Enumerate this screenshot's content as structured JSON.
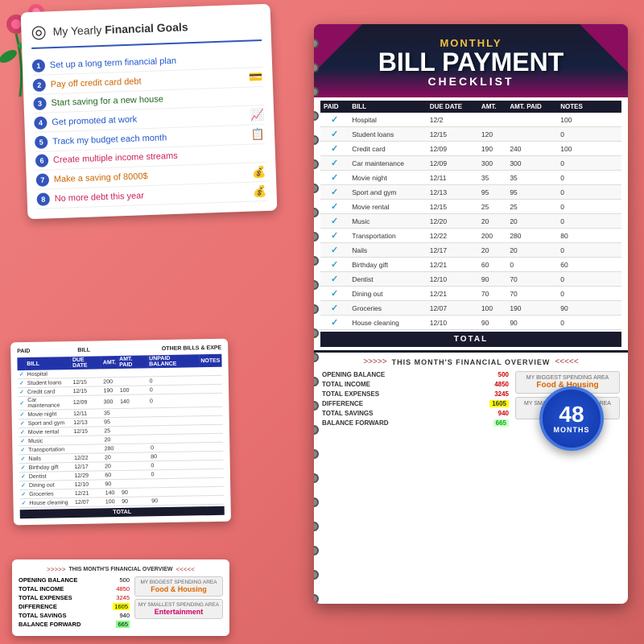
{
  "goals": {
    "title_start": "My Yearly ",
    "title_bold": "Financial Goals",
    "icon": "◎",
    "items": [
      {
        "num": 1,
        "text": "Set up a long term financial plan",
        "style": "blue",
        "icon": ""
      },
      {
        "num": 2,
        "text": "Pay off credit card debt",
        "style": "orange",
        "icon": "💳"
      },
      {
        "num": 3,
        "text": "Start saving for a new house",
        "style": "green",
        "icon": ""
      },
      {
        "num": 4,
        "text": "Get promoted at work",
        "style": "blue",
        "icon": "📈"
      },
      {
        "num": 5,
        "text": "Track my budget each month",
        "style": "blue",
        "icon": "📋"
      },
      {
        "num": 6,
        "text": "Create multiple income streams",
        "style": "pink",
        "icon": ""
      },
      {
        "num": 7,
        "text": "Make a saving of 8000$",
        "style": "orange",
        "icon": "💰"
      },
      {
        "num": 8,
        "text": "No more debt this year",
        "style": "pink",
        "icon": "💰"
      }
    ]
  },
  "main_card": {
    "monthly_label": "MONTHLY",
    "title_line1": "BILL PAYMENT",
    "title_line2": "CHECKLIST",
    "col_paid": "PAID",
    "col_bill": "BILL",
    "col_date": "DUE DATE",
    "col_amt": "AMT.",
    "col_amt_paid": "AMT. PAID",
    "col_unpaid": "UNPAID BALANCE",
    "col_notes": "NOTES",
    "bills": [
      {
        "paid": true,
        "bill": "Hospital",
        "date": "12/2",
        "amt": "",
        "amt_paid": "",
        "unpaid": "100",
        "notes": ""
      },
      {
        "paid": true,
        "bill": "Student loans",
        "date": "12/15",
        "amt": "120",
        "amt_paid": "",
        "unpaid": "0",
        "notes": ""
      },
      {
        "paid": true,
        "bill": "Credit card",
        "date": "12/09",
        "amt": "190",
        "amt_paid": "240",
        "unpaid": "100",
        "notes": ""
      },
      {
        "paid": true,
        "bill": "Car maintenance",
        "date": "12/09",
        "amt": "300",
        "amt_paid": "300",
        "unpaid": "0",
        "notes": ""
      },
      {
        "paid": true,
        "bill": "Movie night",
        "date": "12/11",
        "amt": "35",
        "amt_paid": "35",
        "unpaid": "0",
        "notes": ""
      },
      {
        "paid": true,
        "bill": "Sport and gym",
        "date": "12/13",
        "amt": "95",
        "amt_paid": "95",
        "unpaid": "0",
        "notes": ""
      },
      {
        "paid": true,
        "bill": "Movie rental",
        "date": "12/15",
        "amt": "25",
        "amt_paid": "25",
        "unpaid": "0",
        "notes": ""
      },
      {
        "paid": true,
        "bill": "Music",
        "date": "12/20",
        "amt": "20",
        "amt_paid": "20",
        "unpaid": "0",
        "notes": ""
      },
      {
        "paid": true,
        "bill": "Transportation",
        "date": "12/22",
        "amt": "200",
        "amt_paid": "280",
        "unpaid": "80",
        "notes": ""
      },
      {
        "paid": true,
        "bill": "Nails",
        "date": "12/17",
        "amt": "20",
        "amt_paid": "20",
        "unpaid": "0",
        "notes": ""
      },
      {
        "paid": true,
        "bill": "Birthday gift",
        "date": "12/21",
        "amt": "60",
        "amt_paid": "0",
        "unpaid": "60",
        "notes": ""
      },
      {
        "paid": true,
        "bill": "Dentist",
        "date": "12/10",
        "amt": "90",
        "amt_paid": "70",
        "unpaid": "0",
        "notes": ""
      },
      {
        "paid": true,
        "bill": "Dining out",
        "date": "12/21",
        "amt": "70",
        "amt_paid": "70",
        "unpaid": "0",
        "notes": ""
      },
      {
        "paid": true,
        "bill": "Groceries",
        "date": "12/07",
        "amt": "100",
        "amt_paid": "190",
        "unpaid": "90",
        "notes": ""
      },
      {
        "paid": true,
        "bill": "House cleaning",
        "date": "12/10",
        "amt": "90",
        "amt_paid": "90",
        "unpaid": "0",
        "notes": ""
      }
    ],
    "total_label": "TOTAL",
    "months_num": "48",
    "months_label": "MONTHS",
    "overview_title": "THIS MONTH'S FINANCIAL OVERVIEW",
    "overview_rows": [
      {
        "label": "OPENING BALANCE",
        "value": "500",
        "style": "normal"
      },
      {
        "label": "TOTAL INCOME",
        "value": "4850",
        "style": "red"
      },
      {
        "label": "TOTAL EXPENSES",
        "value": "3245",
        "style": "red"
      },
      {
        "label": "DIFFERENCE",
        "value": "1605",
        "style": "yellow"
      },
      {
        "label": "TOTAL SAVINGS",
        "value": "940",
        "style": "normal"
      },
      {
        "label": "BALANCE FORWARD",
        "value": "665",
        "style": "green"
      }
    ],
    "biggest_area_label": "MY BIGGEST SPENDING AREA",
    "biggest_area_value": "Food & Housing",
    "smallest_area_label": "MY SMALLEST SPENDING AREA",
    "smallest_area_value": "Entertainment"
  }
}
